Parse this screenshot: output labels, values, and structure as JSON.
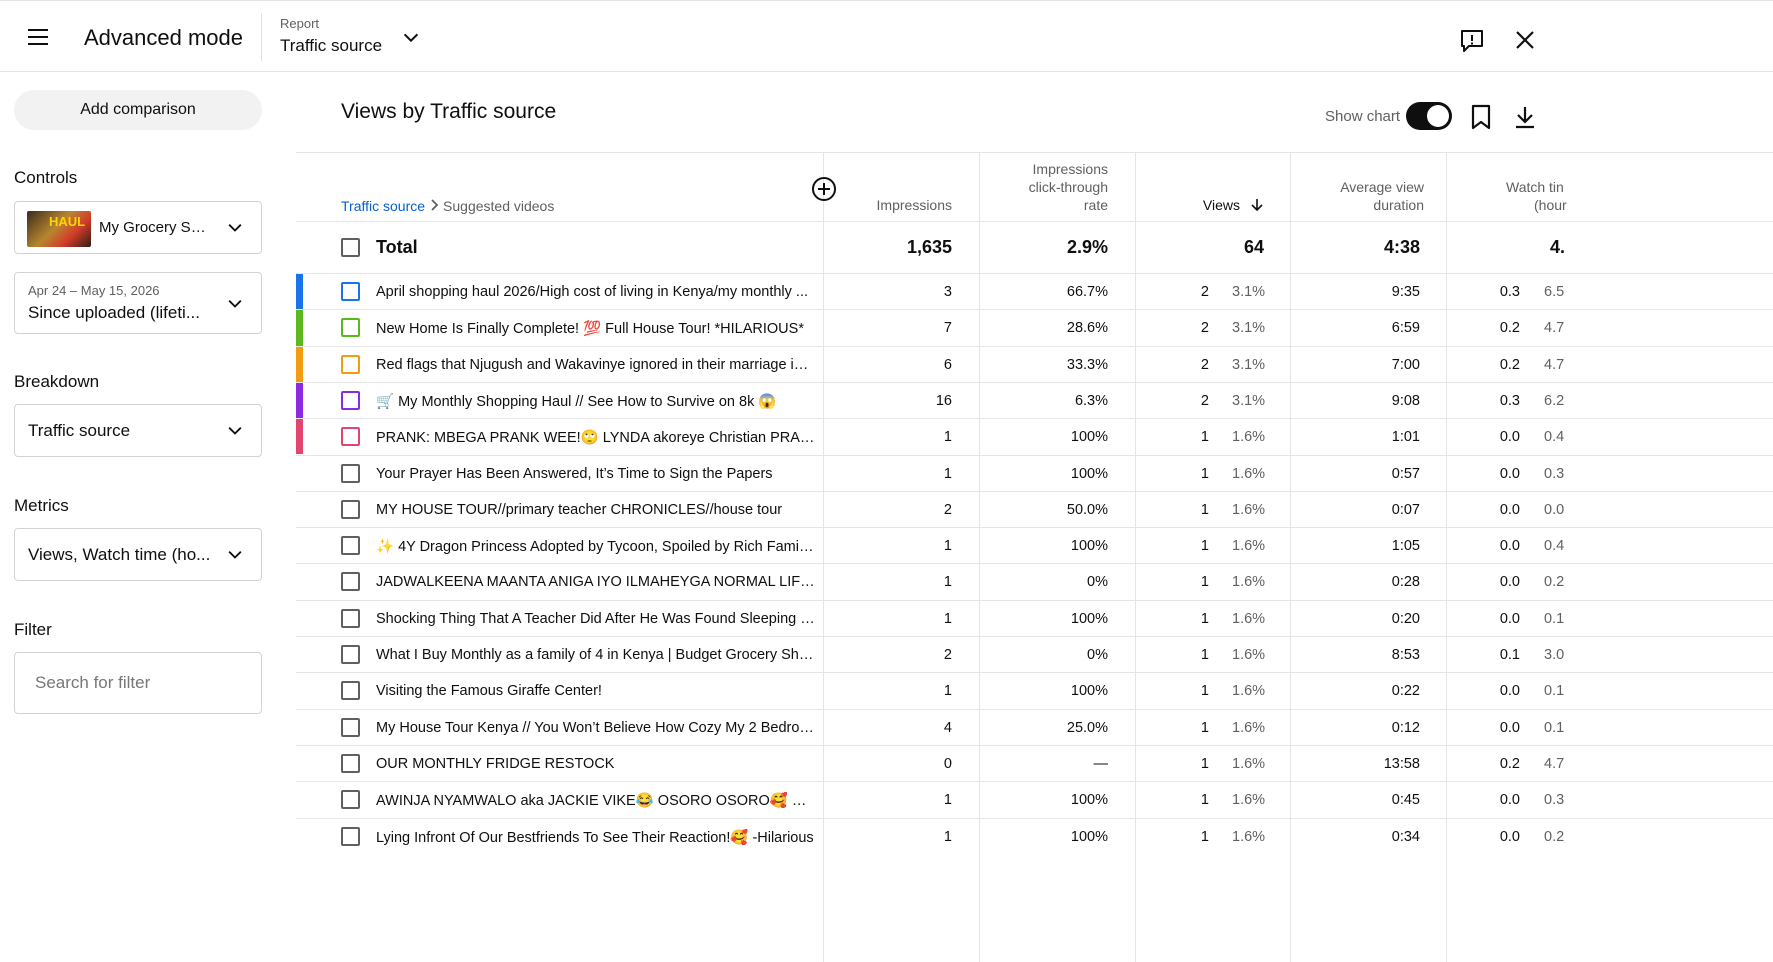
{
  "header": {
    "mode_title": "Advanced mode",
    "report_label": "Report",
    "report_value": "Traffic source"
  },
  "sidebar": {
    "add_comparison": "Add comparison",
    "controls_label": "Controls",
    "video_name": "My Grocery Sh...",
    "video_thumb_text": "HAUL",
    "date_range_small": "Apr 24 – May 15, 2026",
    "date_range_value": "Since uploaded (lifeti...",
    "breakdown_label": "Breakdown",
    "breakdown_value": "Traffic source",
    "metrics_label": "Metrics",
    "metrics_value": "Views, Watch time (ho...",
    "filter_label": "Filter",
    "filter_placeholder": "Search for filter"
  },
  "main": {
    "title": "Views by Traffic source",
    "show_chart_label": "Show chart"
  },
  "table": {
    "crumb_link": "Traffic source",
    "crumb_current": "Suggested videos",
    "columns": {
      "impressions": "Impressions",
      "ctr_line1": "Impressions",
      "ctr_line2": "click-through",
      "ctr_line3": "rate",
      "views": "Views",
      "avd_line1": "Average view",
      "avd_line2": "duration",
      "watch_line1": "Watch tin",
      "watch_line2": "(hour"
    },
    "total": {
      "label": "Total",
      "impressions": "1,635",
      "ctr": "2.9%",
      "views": "64",
      "avd": "4:38",
      "watch": "4."
    },
    "rows": [
      {
        "title": "April shopping haul 2026/High cost of living in Kenya/my monthly ...",
        "impressions": "3",
        "ctr": "66.7%",
        "views": "2",
        "views_pct": "3.1%",
        "avd": "9:35",
        "watch": "0.3",
        "watch_pct": "6.5"
      },
      {
        "title": "New Home Is Finally Complete! 💯 Full House Tour! *HILARIOUS*",
        "impressions": "7",
        "ctr": "28.6%",
        "views": "2",
        "views_pct": "3.1%",
        "avd": "6:59",
        "watch": "0.2",
        "watch_pct": "4.7"
      },
      {
        "title": "Red flags that Njugush and Wakavinye ignored in their marriage in ...",
        "impressions": "6",
        "ctr": "33.3%",
        "views": "2",
        "views_pct": "3.1%",
        "avd": "7:00",
        "watch": "0.2",
        "watch_pct": "4.7"
      },
      {
        "title": "🛒 My Monthly Shopping Haul // See How to Survive on 8k 😱",
        "impressions": "16",
        "ctr": "6.3%",
        "views": "2",
        "views_pct": "3.1%",
        "avd": "9:08",
        "watch": "0.3",
        "watch_pct": "6.2"
      },
      {
        "title": "PRANK: MBEGA PRANK WEE!🙄 LYNDA akoreye Christian PRANK i...",
        "impressions": "1",
        "ctr": "100%",
        "views": "1",
        "views_pct": "1.6%",
        "avd": "1:01",
        "watch": "0.0",
        "watch_pct": "0.4"
      },
      {
        "title": "Your Prayer Has Been Answered, It’s Time to Sign the Papers",
        "impressions": "1",
        "ctr": "100%",
        "views": "1",
        "views_pct": "1.6%",
        "avd": "0:57",
        "watch": "0.0",
        "watch_pct": "0.3"
      },
      {
        "title": "MY HOUSE TOUR//primary teacher CHRONICLES//house tour",
        "impressions": "2",
        "ctr": "50.0%",
        "views": "1",
        "views_pct": "1.6%",
        "avd": "0:07",
        "watch": "0.0",
        "watch_pct": "0.0"
      },
      {
        "title": "✨ 4Y Dragon Princess Adopted by Tycoon, Spoiled by Rich Family, ...",
        "impressions": "1",
        "ctr": "100%",
        "views": "1",
        "views_pct": "1.6%",
        "avd": "1:05",
        "watch": "0.0",
        "watch_pct": "0.4"
      },
      {
        "title": "JADWALKEENA MAANTA ANIGA IYO ILMAHEYGA NORMAL LIFE ..",
        "impressions": "1",
        "ctr": "0%",
        "views": "1",
        "views_pct": "1.6%",
        "avd": "0:28",
        "watch": "0.0",
        "watch_pct": "0.2"
      },
      {
        "title": "Shocking Thing That A Teacher Did After He Was Found Sleeping In...",
        "impressions": "1",
        "ctr": "100%",
        "views": "1",
        "views_pct": "1.6%",
        "avd": "0:20",
        "watch": "0.0",
        "watch_pct": "0.1"
      },
      {
        "title": "What I Buy Monthly as a family of 4 in Kenya | Budget Grocery Shop...",
        "impressions": "2",
        "ctr": "0%",
        "views": "1",
        "views_pct": "1.6%",
        "avd": "8:53",
        "watch": "0.1",
        "watch_pct": "3.0"
      },
      {
        "title": "Visiting the Famous Giraffe Center!",
        "impressions": "1",
        "ctr": "100%",
        "views": "1",
        "views_pct": "1.6%",
        "avd": "0:22",
        "watch": "0.0",
        "watch_pct": "0.1"
      },
      {
        "title": "My House Tour Kenya // You Won’t Believe How Cozy My 2 Bedroo...",
        "impressions": "4",
        "ctr": "25.0%",
        "views": "1",
        "views_pct": "1.6%",
        "avd": "0:12",
        "watch": "0.0",
        "watch_pct": "0.1"
      },
      {
        "title": "OUR MONTHLY FRIDGE RESTOCK",
        "impressions": "0",
        "ctr": "—",
        "views": "1",
        "views_pct": "1.6%",
        "avd": "13:58",
        "watch": "0.2",
        "watch_pct": "4.7"
      },
      {
        "title": "AWINJA NYAMWALO aka JACKIE VIKE😂 OSORO OSORO🥰 🤣 😂 ...",
        "impressions": "1",
        "ctr": "100%",
        "views": "1",
        "views_pct": "1.6%",
        "avd": "0:45",
        "watch": "0.0",
        "watch_pct": "0.3"
      },
      {
        "title": "Lying Infront Of Our Bestfriends To See Their Reaction!🥰 -Hilarious",
        "impressions": "1",
        "ctr": "100%",
        "views": "1",
        "views_pct": "1.6%",
        "avd": "0:34",
        "watch": "0.0",
        "watch_pct": "0.2"
      }
    ],
    "row_colors": [
      "#1a73e8",
      "#5bb81f",
      "#f29c11",
      "#8a2be2",
      "#e2456f"
    ]
  }
}
